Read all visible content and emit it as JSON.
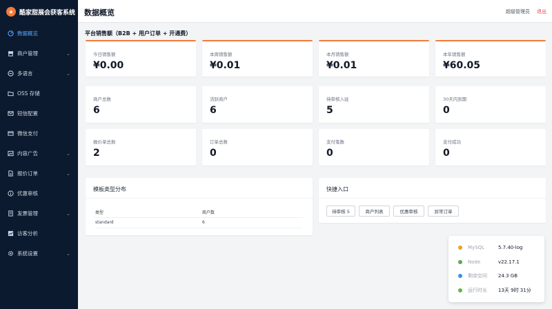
{
  "app": {
    "title": "酷家甜展会获客系统",
    "logo_glyph": "★"
  },
  "sidebar": {
    "items": [
      {
        "label": "数据概览",
        "icon": "dashboard-icon",
        "active": true,
        "chevron": false
      },
      {
        "label": "商户管理",
        "icon": "store-icon",
        "active": false,
        "chevron": true
      },
      {
        "label": "多语言",
        "icon": "language-icon",
        "active": false,
        "chevron": true
      },
      {
        "label": "OSS 存储",
        "icon": "folder-icon",
        "active": false,
        "chevron": false
      },
      {
        "label": "短信配置",
        "icon": "mail-icon",
        "active": false,
        "chevron": false
      },
      {
        "label": "微信支付",
        "icon": "wallet-icon",
        "active": false,
        "chevron": false
      },
      {
        "label": "内容广告",
        "icon": "image-icon",
        "active": false,
        "chevron": true
      },
      {
        "label": "报价订单",
        "icon": "document-icon",
        "active": false,
        "chevron": true
      },
      {
        "label": "优惠审核",
        "icon": "info-icon",
        "active": false,
        "chevron": false
      },
      {
        "label": "发票管理",
        "icon": "invoice-icon",
        "active": false,
        "chevron": true
      },
      {
        "label": "访客分析",
        "icon": "chart-icon",
        "active": false,
        "chevron": false
      },
      {
        "label": "系统设置",
        "icon": "gear-icon",
        "active": false,
        "chevron": true
      }
    ]
  },
  "header": {
    "title": "数据概览",
    "user": "超级管理员",
    "logout": "退出"
  },
  "sales": {
    "title": "平台销售额（B2B + 用户订单 + 开通费）",
    "cards": [
      {
        "label": "今日销售额",
        "value": "¥0.00"
      },
      {
        "label": "本周销售额",
        "value": "¥0.01"
      },
      {
        "label": "本月销售额",
        "value": "¥0.01"
      },
      {
        "label": "本年销售额",
        "value": "¥60.05"
      }
    ]
  },
  "stats": [
    {
      "label": "商户总数",
      "value": "6"
    },
    {
      "label": "活跃商户",
      "value": "6"
    },
    {
      "label": "待审核入驻",
      "value": "5"
    },
    {
      "label": "30天内到期",
      "value": "0"
    },
    {
      "label": "报价单总数",
      "value": "2"
    },
    {
      "label": "订单总数",
      "value": "0"
    },
    {
      "label": "支付笔数",
      "value": "0"
    },
    {
      "label": "支付成功",
      "value": "0"
    }
  ],
  "template_panel": {
    "title": "模板类型分布",
    "columns": [
      "类型",
      "商户数"
    ],
    "rows": [
      [
        "standard",
        "6"
      ]
    ]
  },
  "quick": {
    "title": "快捷入口",
    "buttons": [
      "待审核 5",
      "商户列表",
      "优惠审核",
      "异常订单"
    ]
  },
  "status": {
    "items": [
      {
        "label": "MySQL",
        "value": "5.7.40-log",
        "color": "#f0a020"
      },
      {
        "label": "Node",
        "value": "v22.17.1",
        "color": "#5fa85a"
      },
      {
        "label": "剩余空间",
        "value": "24.3 GB",
        "color": "#3b8fe8"
      },
      {
        "label": "运行时长",
        "value": "13天 9时 31分",
        "color": "#5fb84a"
      }
    ]
  },
  "colors": {
    "accent": "#f27a3b",
    "sidebar_bg": "#0b1a2e",
    "active_nav": "#5aa7ff",
    "logout": "#ef4444"
  }
}
